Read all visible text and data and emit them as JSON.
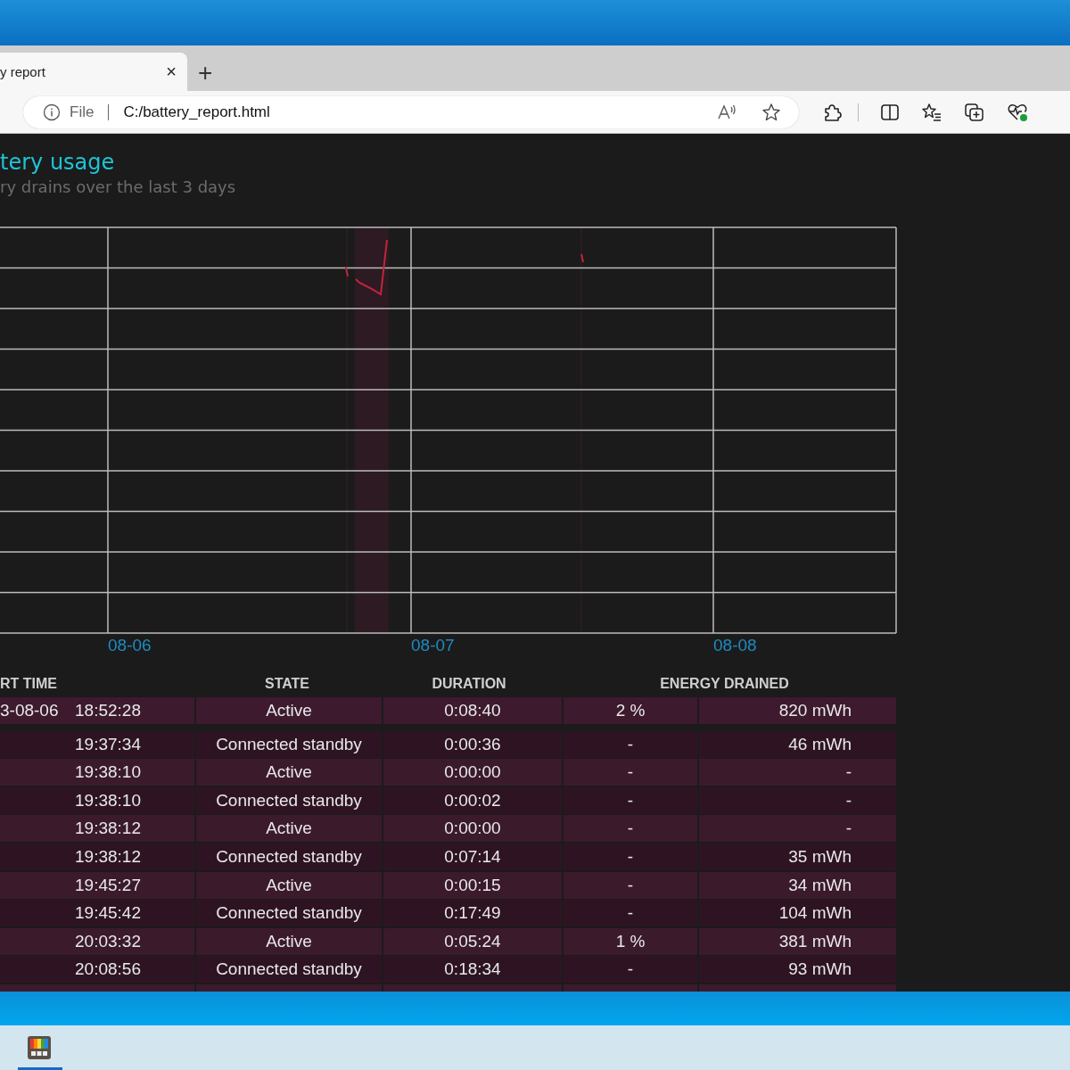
{
  "browser": {
    "tab": {
      "title": "y report",
      "close": "×",
      "selected": true
    },
    "new_tab": "+",
    "address": {
      "scheme": "File",
      "url": "C:/battery_report.html"
    }
  },
  "page": {
    "title": "tery usage",
    "subtitle": "ry drains over the last 3 days",
    "chart": {
      "x_labels": [
        "08-06",
        "08-07",
        "08-08"
      ]
    },
    "table": {
      "columns": [
        "RT TIME",
        "STATE",
        "DURATION",
        "ENERGY DRAINED"
      ],
      "rows": [
        {
          "date": "3-08-06",
          "time": "18:52:28",
          "state": "Active",
          "duration": "0:08:40",
          "percent": "2 %",
          "energy": "820 mWh"
        },
        {
          "time": "19:37:34",
          "state": "Connected standby",
          "duration": "0:00:36",
          "percent": "-",
          "energy": "46 mWh"
        },
        {
          "time": "19:38:10",
          "state": "Active",
          "duration": "0:00:00",
          "percent": "-",
          "energy": "-"
        },
        {
          "time": "19:38:10",
          "state": "Connected standby",
          "duration": "0:00:02",
          "percent": "-",
          "energy": "-"
        },
        {
          "time": "19:38:12",
          "state": "Active",
          "duration": "0:00:00",
          "percent": "-",
          "energy": "-"
        },
        {
          "time": "19:38:12",
          "state": "Connected standby",
          "duration": "0:07:14",
          "percent": "-",
          "energy": "35 mWh"
        },
        {
          "time": "19:45:27",
          "state": "Active",
          "duration": "0:00:15",
          "percent": "-",
          "energy": "34 mWh"
        },
        {
          "time": "19:45:42",
          "state": "Connected standby",
          "duration": "0:17:49",
          "percent": "-",
          "energy": "104 mWh"
        },
        {
          "time": "20:03:32",
          "state": "Active",
          "duration": "0:05:24",
          "percent": "1 %",
          "energy": "381 mWh"
        },
        {
          "time": "20:08:56",
          "state": "Connected standby",
          "duration": "0:18:34",
          "percent": "-",
          "energy": "93 mWh"
        }
      ]
    }
  }
}
